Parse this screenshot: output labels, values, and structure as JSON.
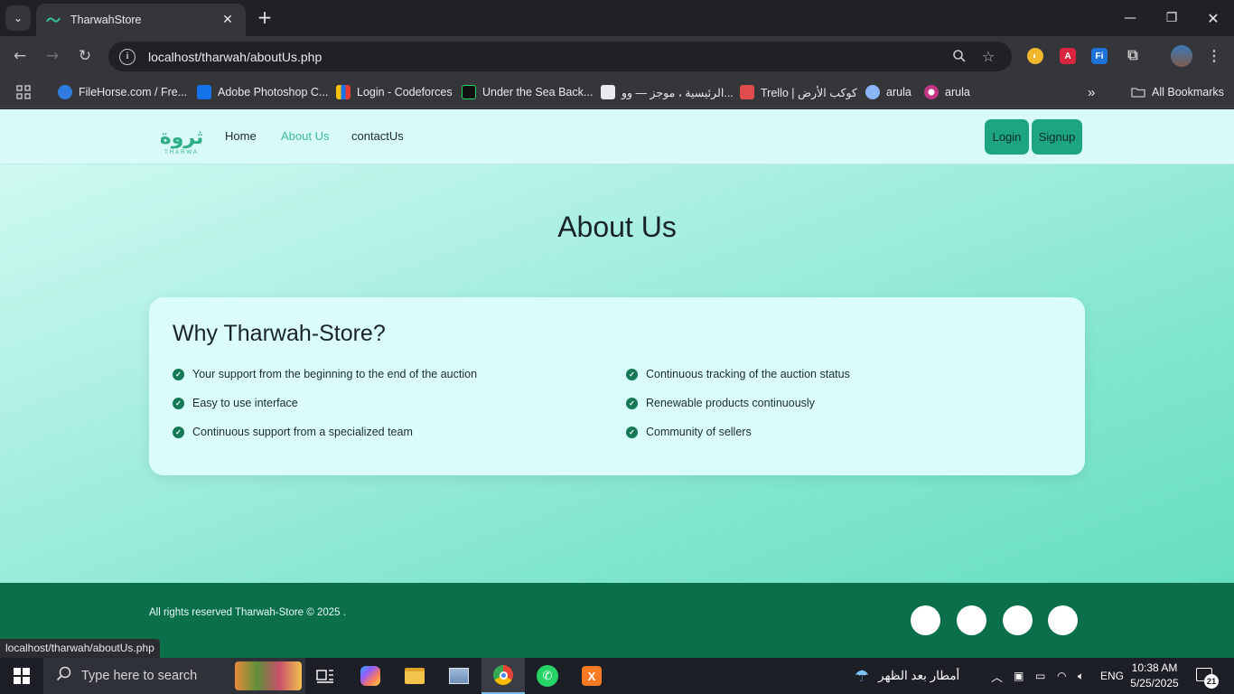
{
  "browser": {
    "tab_title": "TharwahStore",
    "address": "localhost/tharwah/aboutUs.php",
    "all_bookmarks": "All Bookmarks",
    "bookmarks": [
      {
        "label": "FileHorse.com / Fre...",
        "color": "#2f7de1"
      },
      {
        "label": "Adobe Photoshop C...",
        "color": "#1473e6"
      },
      {
        "label": "Login - Codeforces",
        "color": "#f4c20d"
      },
      {
        "label": "Under the Sea Back...",
        "color": "#1ed760"
      },
      {
        "label": "الرئيسية ، موجز — وو...",
        "color": "#9aa0a6"
      },
      {
        "label": "Trello | كوكب الأرض",
        "color": "#e04b4b"
      },
      {
        "label": "arula",
        "color": "#8ab4f8"
      },
      {
        "label": "arula",
        "color": "#c13584"
      }
    ],
    "status_url": "localhost/tharwah/aboutUs.php"
  },
  "site": {
    "logo_text": "ثروة",
    "logo_sub": "THARWA",
    "brand_color": "#1da583",
    "nav": {
      "home": "Home",
      "about": "About Us",
      "contact": "contactUs"
    },
    "login_label": "Login",
    "signup_label": "Signup",
    "page_title": "About Us",
    "card": {
      "title": "Why Tharwah-Store?",
      "features_left": [
        "Your support from the beginning to the end of the auction",
        "Easy to use interface",
        "Continuous support from a specialized team"
      ],
      "features_right": [
        "Continuous tracking of the auction status",
        "Renewable products continuously",
        "Community of sellers"
      ]
    },
    "footer": {
      "copyright": "All rights reserved Tharwah-Store © 2025 .",
      "social_icons": [
        "facebook-icon",
        "twitter-icon",
        "instagram-icon",
        "google-icon"
      ]
    }
  },
  "taskbar": {
    "search_placeholder": "Type here to search",
    "weather": "أمطار بعد الظهر",
    "language": "ENG",
    "time": "10:38 AM",
    "date": "5/25/2025",
    "notifications": "21"
  }
}
